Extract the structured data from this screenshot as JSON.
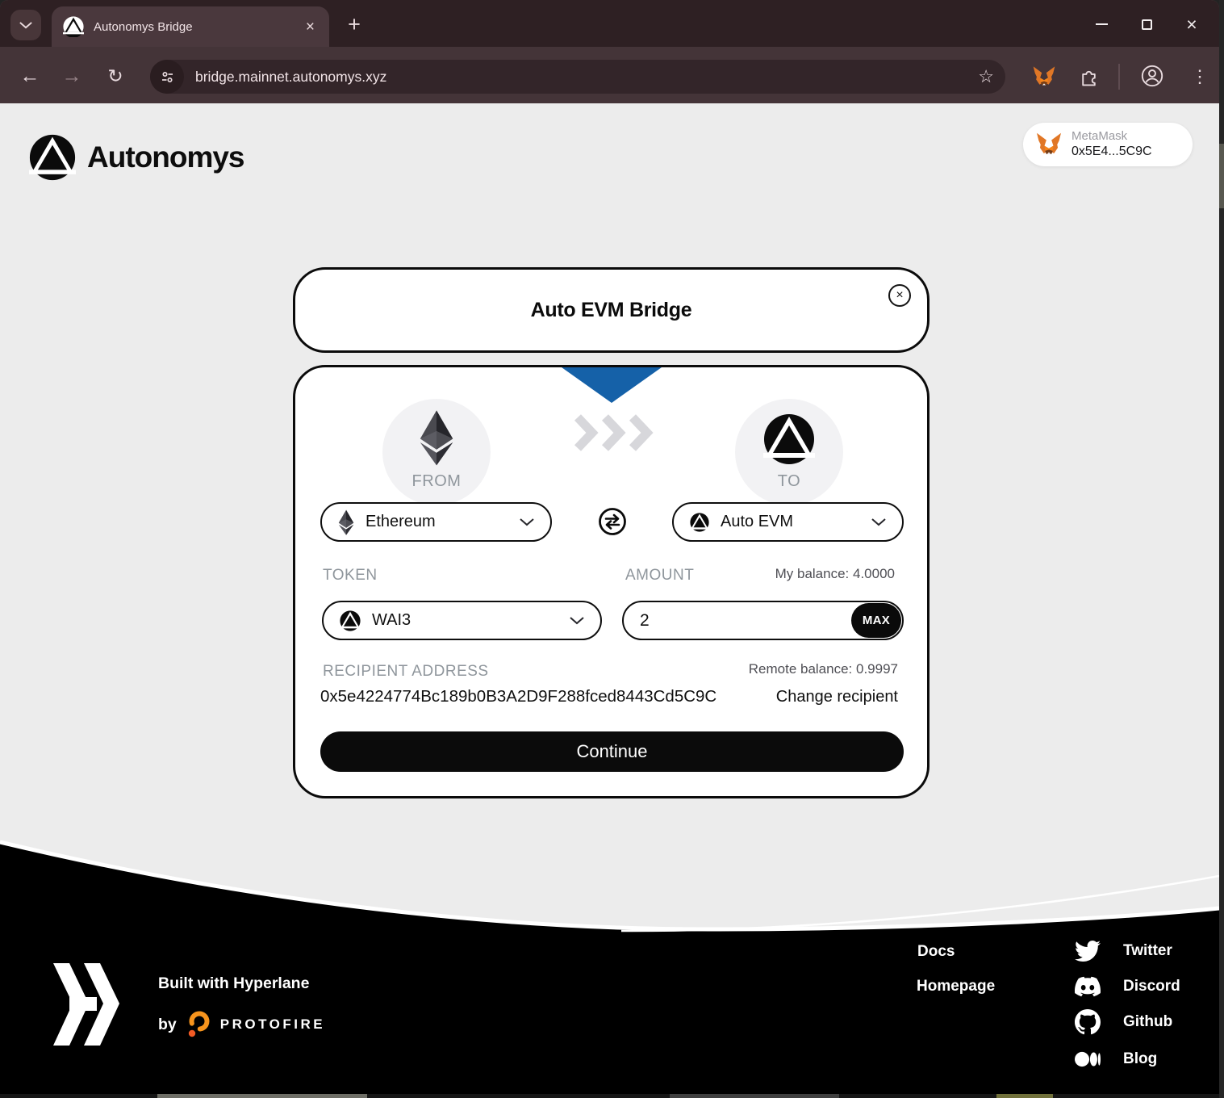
{
  "theme": {
    "chrome-bg": "#2e2023",
    "chrome-tab": "#4a383d",
    "chrome-toolbar": "#443438",
    "chrome-url": "#332529",
    "page-bg": "#ececec",
    "ink": "#0b0b0b",
    "muted": "#8f969c",
    "accent-blue": "#1561a8",
    "footer-bg": "#000000"
  },
  "icons": {
    "close": "×",
    "plus": "+",
    "back": "←",
    "forward": "→",
    "reload": "↻",
    "star": "☆",
    "kebab": "⋮"
  },
  "browser": {
    "tab_title": "Autonomys Bridge",
    "url": "bridge.mainnet.autonomys.xyz"
  },
  "header": {
    "brand": "Autonomys",
    "wallet_name": "MetaMask",
    "wallet_address": "0x5E4...5C9C"
  },
  "bridge": {
    "title": "Auto EVM Bridge",
    "from_label": "FROM",
    "to_label": "TO",
    "from_network": "Ethereum",
    "to_network": "Auto EVM",
    "token_label": "TOKEN",
    "token": "WAI3",
    "amount_label": "AMOUNT",
    "amount": "2",
    "max_label": "MAX",
    "balance_label": "My balance: 4.0000",
    "recipient_label": "RECIPIENT ADDRESS",
    "recipient_address": "0x5e4224774Bc189b0B3A2D9F288fced8443Cd5C9C",
    "remote_balance_label": "Remote balance: 0.9997",
    "change_recipient": "Change recipient",
    "continue_label": "Continue"
  },
  "footer": {
    "built_with": "Built with Hyperlane",
    "by": "by",
    "protofire": "PROTOFIRE",
    "links": [
      {
        "label": "Docs"
      },
      {
        "label": "Homepage"
      }
    ],
    "social": [
      {
        "label": "Twitter"
      },
      {
        "label": "Discord"
      },
      {
        "label": "Github"
      },
      {
        "label": "Blog"
      }
    ]
  }
}
